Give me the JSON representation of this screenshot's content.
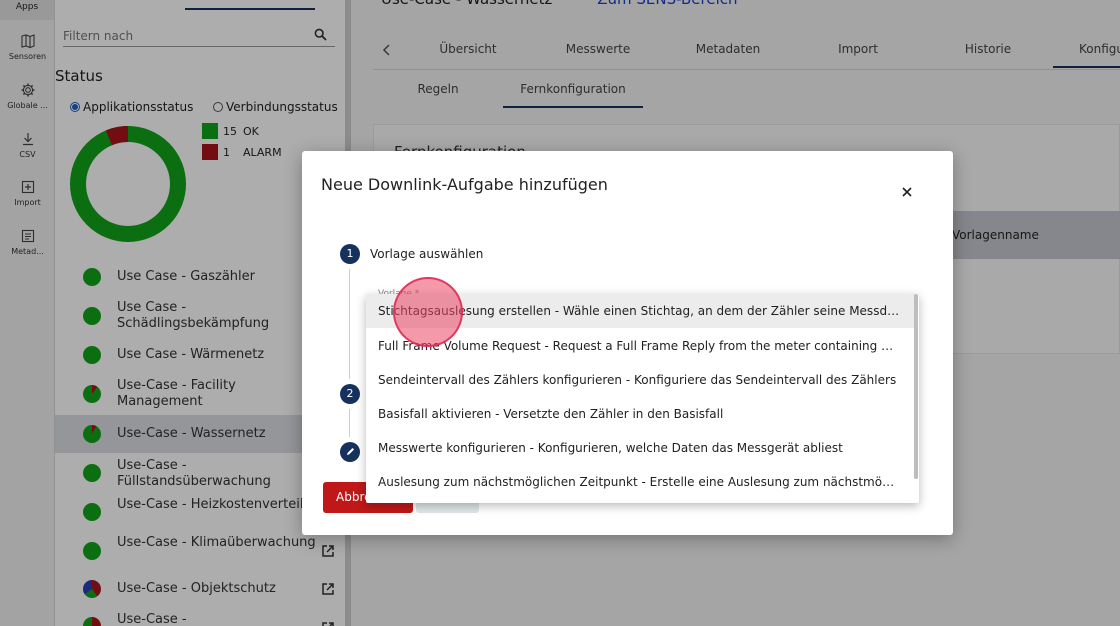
{
  "rail": {
    "apps_label": "Apps",
    "items": [
      {
        "label": "Sensoren",
        "icon": "map-icon"
      },
      {
        "label": "Globale ...",
        "icon": "gear-icon"
      },
      {
        "label": "CSV",
        "icon": "download-icon"
      },
      {
        "label": "Import",
        "icon": "add-box-icon"
      },
      {
        "label": "Metad...",
        "icon": "list-icon"
      }
    ]
  },
  "sidebar": {
    "filter_placeholder": "Filtern nach",
    "status_title": "Status",
    "radio_app": "Applikationsstatus",
    "radio_conn": "Verbindungsstatus",
    "legend": [
      {
        "count": "15",
        "label": "OK",
        "color": "#11a31a"
      },
      {
        "count": "1",
        "label": "ALARM",
        "color": "#a8161c"
      }
    ],
    "donut": {
      "ok": 15,
      "alarm": 1
    },
    "use_cases": [
      {
        "label": "Use Case - Gaszähler"
      },
      {
        "label": "Use Case - Schädlingsbekämpfung"
      },
      {
        "label": "Use Case - Wärmenetz"
      },
      {
        "label": "Use-Case - Facility Management"
      },
      {
        "label": "Use-Case - Wassernetz"
      },
      {
        "label": "Use-Case - Füllstandsüberwachung"
      },
      {
        "label": "Use-Case - Heizkostenverteiler"
      },
      {
        "label": "Use-Case - Klimaüberwachung"
      },
      {
        "label": "Use-Case - Objektschutz"
      },
      {
        "label": "Use-Case -"
      }
    ]
  },
  "main": {
    "breadcrumb": "Use-Case - Wassernetz",
    "breadcrumb_link": "Zum SENS-Bereich",
    "tabs": [
      "Übersicht",
      "Messwerte",
      "Metadaten",
      "Import",
      "Historie",
      "Konfigu"
    ],
    "subtabs": [
      "Regeln",
      "Fernkonfiguration"
    ],
    "card_title": "Fernkonfiguration",
    "table_header": "Vorlagenname"
  },
  "modal": {
    "title": "Neue Downlink-Aufgabe hinzufügen",
    "step1_num": "1",
    "step1_label": "Vorlage auswählen",
    "template_field_label": "Vorlage *",
    "step2_num": "2",
    "cancel_label": "Abbrechen",
    "options": [
      "Stichtagsauslesung erstellen - Wähle einen Stichtag, an dem der Zähler seine Messdaten erfasst",
      "Full Frame Volume Request - Request a Full Frame Reply from the meter containing at least the volume",
      "Sendeintervall des Zählers konfigurieren - Konfiguriere das Sendeintervall des Zählers",
      "Basisfall aktivieren - Versetzte den Zähler in den Basisfall",
      "Messwerte konfigurieren - Konfigurieren, welche Daten das Messgerät abliest",
      "Auslesung zum nächstmöglichen Zeitpunkt - Erstelle eine Auslesung zum nächstmöglichen Zeitpunkt"
    ]
  }
}
